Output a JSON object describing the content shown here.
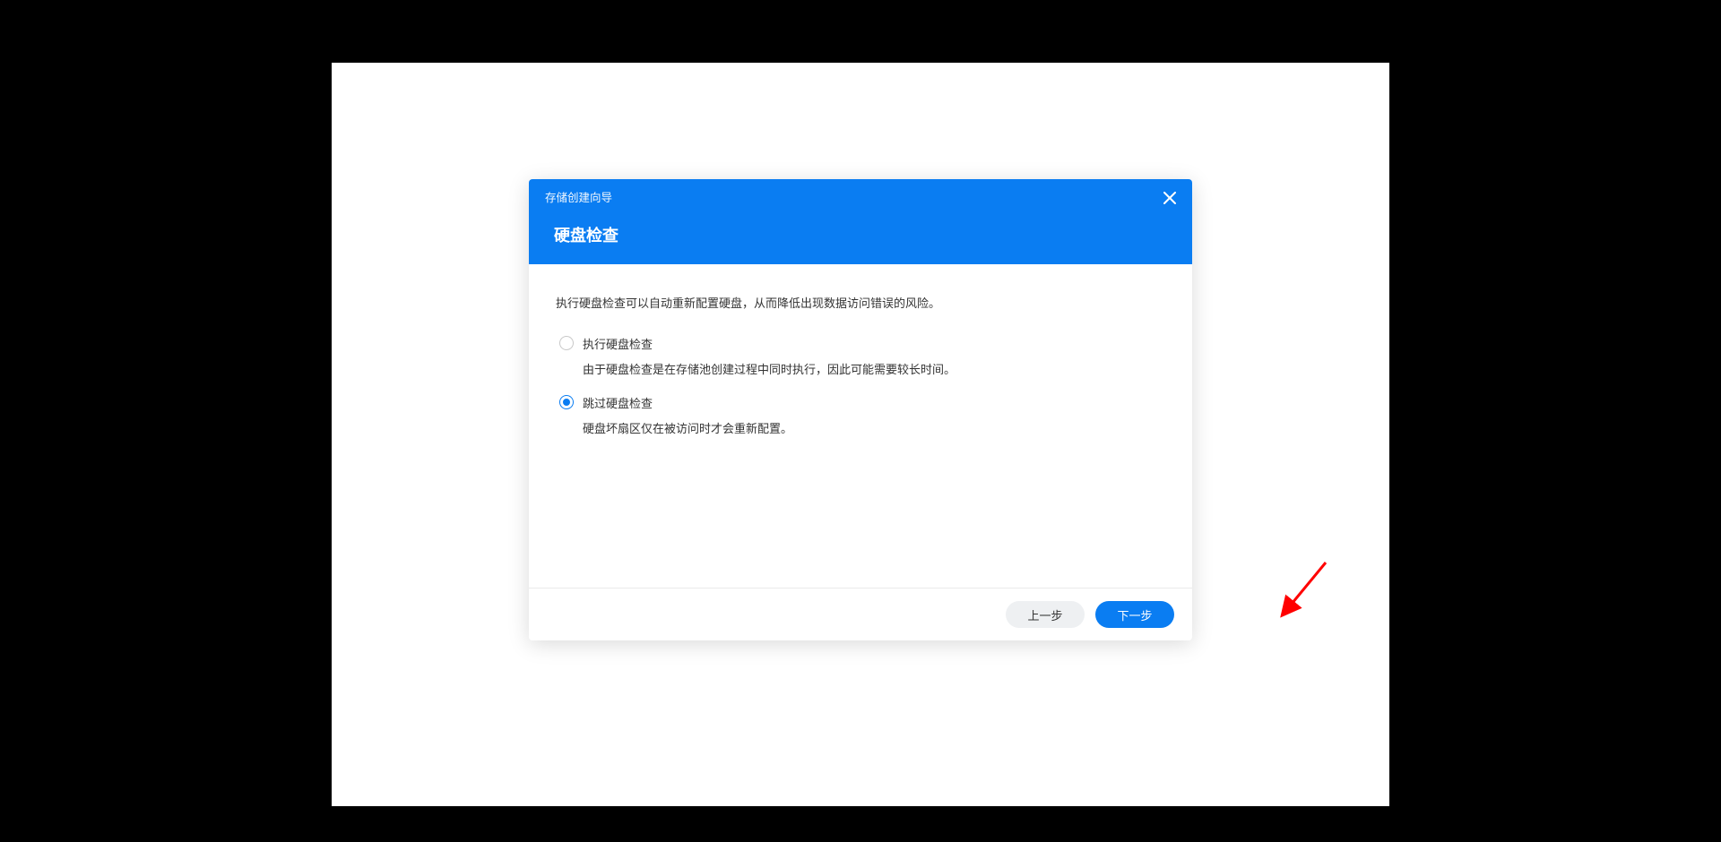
{
  "dialog": {
    "title_small": "存储创建向导",
    "title_large": "硬盘检查",
    "description": "执行硬盘检查可以自动重新配置硬盘，从而降低出现数据访问错误的风险。",
    "options": [
      {
        "label": "执行硬盘检查",
        "help": "由于硬盘检查是在存储池创建过程中同时执行，因此可能需要较长时间。",
        "checked": false
      },
      {
        "label": "跳过硬盘检查",
        "help": "硬盘坏扇区仅在被访问时才会重新配置。",
        "checked": true
      }
    ],
    "buttons": {
      "back": "上一步",
      "next": "下一步"
    }
  },
  "colors": {
    "primary": "#0a7df2",
    "annotation": "#ff0000"
  }
}
